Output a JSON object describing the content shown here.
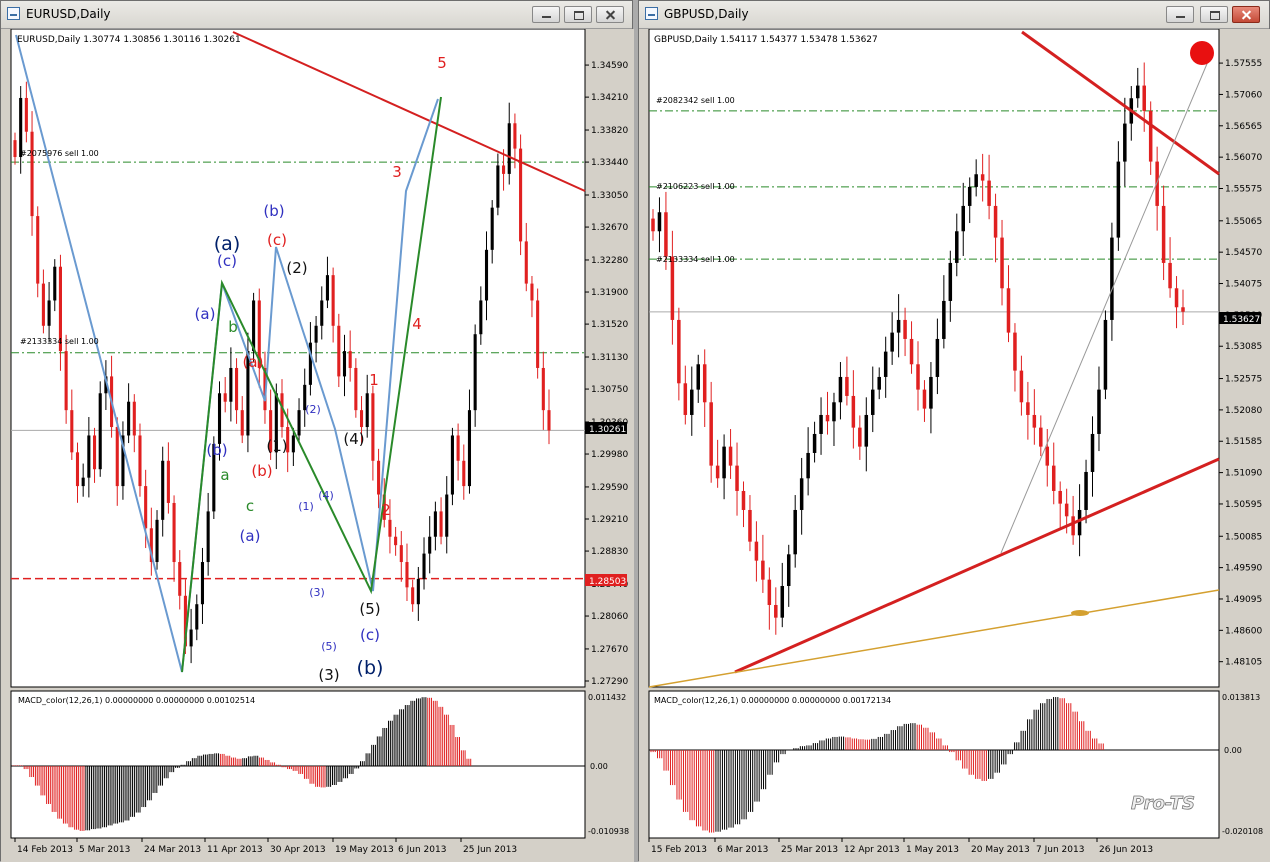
{
  "windows": [
    {
      "title": "EURUSD,Daily",
      "info": "EURUSD,Daily  1.30774 1.30856 1.30116 1.30261",
      "current_price_label": "1.30261",
      "red_hline_label": "1.28503",
      "order_labels": [
        "#2075976 sell 1.00",
        "#2133334 sell 1.00"
      ],
      "indicator_label": "MACD_color(12,26,1) 0.00000000 0.00000000 0.00102514",
      "macd_axis_labels": [
        "0.011432",
        "0.00",
        "-0.010938"
      ],
      "wave_labels": [
        "(a)",
        "(b)",
        "(c)",
        "(a)",
        "(b)",
        "(c)",
        "(a)",
        "(b)",
        "(c)",
        "a",
        "b",
        "c",
        "(1)",
        "(2)",
        "(3)",
        "(4)",
        "(5)",
        "(1)",
        "(2)",
        "(3)",
        "(4)",
        "(5)",
        "1",
        "2",
        "3",
        "4",
        "5",
        "(a)",
        "(b)",
        "(c)",
        "(b)"
      ]
    },
    {
      "title": "GBPUSD,Daily",
      "info": "GBPUSD,Daily  1.54117 1.54377 1.53478 1.53627",
      "current_price_label": "1.53627",
      "order_labels": [
        "#2082342 sell 1.00",
        "#2106223 sell 1.00",
        "#2133334 sell 1.00"
      ],
      "indicator_label": "MACD_color(12,26,1) 0.00000000 0.00000000 0.00172134",
      "macd_axis_labels": [
        "0.013813",
        "0.00",
        "-0.020108"
      ],
      "watermark": "Pro-TS"
    }
  ],
  "colors": {
    "bull": "#000000",
    "bear": "#e02020",
    "trend": "#d42020",
    "wave_blue": "#6a9ad0",
    "wave_green": "#2a8a2a",
    "order_line": "#2a8a2a"
  },
  "chart_data": [
    {
      "type": "candlestick",
      "title": "EURUSD,Daily",
      "ohlc_last": {
        "open": 1.30774,
        "high": 1.30856,
        "low": 1.30116,
        "close": 1.30261
      },
      "y_ticks": [
        1.3459,
        1.3421,
        1.3382,
        1.3344,
        1.3305,
        1.3267,
        1.3228,
        1.319,
        1.3152,
        1.3113,
        1.3075,
        1.3036,
        1.2998,
        1.2959,
        1.2921,
        1.2883,
        1.2844,
        1.2806,
        1.2767,
        1.2729
      ],
      "x_ticks": [
        "14 Feb 2013",
        "5 Mar 2013",
        "24 Mar 2013",
        "11 Apr 2013",
        "30 Apr 2013",
        "19 May 2013",
        "6 Jun 2013",
        "25 Jun 2013"
      ],
      "ylim": [
        1.2729,
        1.3497
      ],
      "horizontal_lines": [
        1.3344,
        1.3118,
        1.28503,
        1.30261
      ],
      "closes": [
        1.335,
        1.342,
        1.338,
        1.328,
        1.32,
        1.315,
        1.318,
        1.322,
        1.312,
        1.305,
        1.3,
        1.296,
        1.297,
        1.302,
        1.298,
        1.307,
        1.309,
        1.303,
        1.296,
        1.302,
        1.306,
        1.302,
        1.296,
        1.291,
        1.287,
        1.292,
        1.299,
        1.294,
        1.287,
        1.283,
        1.277,
        1.279,
        1.282,
        1.287,
        1.293,
        1.301,
        1.307,
        1.306,
        1.31,
        1.305,
        1.302,
        1.312,
        1.318,
        1.31,
        1.305,
        1.3,
        1.307,
        1.303,
        1.3,
        1.302,
        1.305,
        1.308,
        1.313,
        1.315,
        1.318,
        1.321,
        1.315,
        1.309,
        1.312,
        1.31,
        1.305,
        1.303,
        1.307,
        1.299,
        1.295,
        1.292,
        1.29,
        1.289,
        1.287,
        1.284,
        1.282,
        1.285,
        1.288,
        1.29,
        1.293,
        1.29,
        1.295,
        1.302,
        1.299,
        1.296,
        1.305,
        1.314,
        1.318,
        1.324,
        1.329,
        1.334,
        1.333,
        1.339,
        1.336,
        1.325,
        1.32,
        1.318,
        1.31,
        1.305,
        1.3026
      ],
      "macd": [
        0.0001,
        0.0001,
        -0.0005,
        -0.0018,
        -0.0032,
        -0.0048,
        -0.0062,
        -0.0075,
        -0.0086,
        -0.0094,
        -0.01,
        -0.0104,
        -0.0106,
        -0.0105,
        -0.0103,
        -0.0102,
        -0.01,
        -0.0097,
        -0.0094,
        -0.0092,
        -0.0089,
        -0.0083,
        -0.0076,
        -0.0067,
        -0.0056,
        -0.0044,
        -0.0032,
        -0.002,
        -0.001,
        -0.0003,
        0.0002,
        0.0008,
        0.0013,
        0.0017,
        0.0019,
        0.002,
        0.0021,
        0.002,
        0.0017,
        0.0014,
        0.0012,
        0.0013,
        0.0016,
        0.0017,
        0.0014,
        0.001,
        0.0006,
        0.0002,
        -0.0002,
        -0.0005,
        -0.0008,
        -0.0013,
        -0.0021,
        -0.0029,
        -0.0034,
        -0.0035,
        -0.0034,
        -0.0031,
        -0.0026,
        -0.002,
        -0.0013,
        -0.0004,
        0.0008,
        0.0021,
        0.0035,
        0.0049,
        0.0063,
        0.0075,
        0.0085,
        0.0094,
        0.0101,
        0.0108,
        0.0112,
        0.0114,
        0.0113,
        0.0108,
        0.0098,
        0.0085,
        0.0068,
        0.0048,
        0.0026,
        0.0012
      ]
    },
    {
      "type": "candlestick",
      "title": "GBPUSD,Daily",
      "ohlc_last": {
        "open": 1.54117,
        "high": 1.54377,
        "low": 1.53478,
        "close": 1.53627
      },
      "y_ticks": [
        1.57555,
        1.5706,
        1.56565,
        1.5607,
        1.55575,
        1.55065,
        1.5457,
        1.54075,
        1.5358,
        1.53085,
        1.52575,
        1.5208,
        1.51585,
        1.5109,
        1.50595,
        1.50085,
        1.4959,
        1.49095,
        1.486,
        1.48105
      ],
      "x_ticks": [
        "15 Feb 2013",
        "6 Mar 2013",
        "25 Mar 2013",
        "12 Apr 2013",
        "1 May 2013",
        "20 May 2013",
        "7 Jun 2013",
        "26 Jun 2013"
      ],
      "ylim": [
        1.478,
        1.5803
      ],
      "horizontal_lines": [
        1.568,
        1.556,
        1.5446,
        1.53627
      ],
      "closes": [
        1.549,
        1.552,
        1.545,
        1.535,
        1.525,
        1.52,
        1.524,
        1.528,
        1.522,
        1.512,
        1.51,
        1.515,
        1.512,
        1.508,
        1.505,
        1.5,
        1.497,
        1.494,
        1.49,
        1.488,
        1.493,
        1.498,
        1.505,
        1.51,
        1.514,
        1.517,
        1.52,
        1.519,
        1.522,
        1.526,
        1.523,
        1.518,
        1.515,
        1.52,
        1.524,
        1.526,
        1.53,
        1.533,
        1.535,
        1.532,
        1.528,
        1.524,
        1.521,
        1.526,
        1.532,
        1.538,
        1.544,
        1.549,
        1.553,
        1.556,
        1.558,
        1.557,
        1.553,
        1.548,
        1.54,
        1.533,
        1.527,
        1.522,
        1.52,
        1.518,
        1.515,
        1.512,
        1.508,
        1.506,
        1.504,
        1.501,
        1.505,
        1.511,
        1.517,
        1.524,
        1.535,
        1.548,
        1.56,
        1.566,
        1.57,
        1.572,
        1.568,
        1.56,
        1.553,
        1.544,
        1.54,
        1.537,
        1.5363
      ],
      "macd": [
        -0.0005,
        -0.002,
        -0.005,
        -0.0085,
        -0.012,
        -0.015,
        -0.017,
        -0.0185,
        -0.0195,
        -0.02,
        -0.0198,
        -0.0193,
        -0.0188,
        -0.018,
        -0.0168,
        -0.015,
        -0.0125,
        -0.0095,
        -0.006,
        -0.003,
        -0.001,
        0.0,
        0.0005,
        0.001,
        0.0012,
        0.0018,
        0.0025,
        0.003,
        0.0034,
        0.0035,
        0.0033,
        0.003,
        0.0028,
        0.0027,
        0.0029,
        0.0034,
        0.0042,
        0.0052,
        0.0062,
        0.0068,
        0.007,
        0.0066,
        0.0058,
        0.0046,
        0.003,
        0.0012,
        -0.0005,
        -0.0025,
        -0.0045,
        -0.006,
        -0.007,
        -0.0075,
        -0.007,
        -0.0055,
        -0.0035,
        -0.001,
        0.002,
        0.005,
        0.008,
        0.0105,
        0.0122,
        0.0133,
        0.0138,
        0.0135,
        0.0122,
        0.01,
        0.0075,
        0.005,
        0.003,
        0.0017
      ]
    }
  ]
}
